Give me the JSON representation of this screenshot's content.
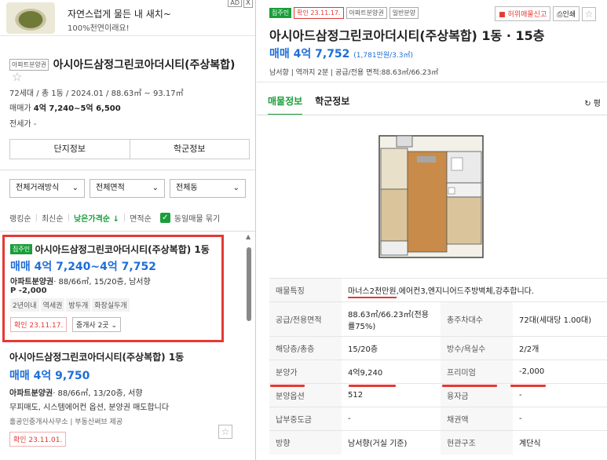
{
  "ad": {
    "title": "자연스럽게 물든 내 새치~",
    "subtitle": "100%천연이래요!",
    "tag": "AD",
    "close": "X"
  },
  "complex": {
    "badge": "아파트분양권",
    "name": "아시아드삼정그린코아더시티(주상복합)",
    "info": "72세대 / 총 1동 / 2024.01 / 88.63㎡ ~ 93.17㎡",
    "price_label": "매매가",
    "price_value": "4억 7,240~5억 6,500",
    "jeonse_label": "전세가",
    "jeonse_value": "-",
    "btn_info": "단지정보",
    "btn_school": "학군정보"
  },
  "filters": {
    "deal": "전체거래방식",
    "area": "전체면적",
    "dong": "전체동"
  },
  "sort": {
    "items": [
      "랭킹순",
      "최신순",
      "낮은가격순 ↓",
      "면적순"
    ],
    "same": "동일매물 묶기"
  },
  "listing1": {
    "tag": "집주인",
    "name": "아시아드삼정그린코아더시티(주상복합) 1동",
    "price": "매매 4억 7,240~4억 7,752",
    "type": "아파트분양권",
    "detail": "· 88/66㎡, 15/20층, 남서향",
    "premium": "P -2,000",
    "chips": [
      "2년이내",
      "역세권",
      "방두개",
      "화장실두개"
    ],
    "confirm": "확인 23.11.17.",
    "broker": "중개사 2곳"
  },
  "listing2": {
    "name": "아시아드삼정그린코아더시티(주상복합) 1동",
    "price": "매매 4억 9,750",
    "type": "아파트분양권",
    "detail": "· 88/66㎡, 13/20층, 서향",
    "desc": "무피매도, 시스템에어컨 옵션, 분양권 매도합니다",
    "source": "홀공인중개사사무소 | 부동산써브 제공",
    "confirm": "확인 23.11.01."
  },
  "detail": {
    "tags": [
      "집주인",
      "확인 23.11.17.",
      "아파트분양권",
      "일반분양"
    ],
    "report": "허위매물신고",
    "print": "인쇄",
    "title": "아시아드삼정그린코아더시티(주상복합) 1동 · 15층",
    "price": "매매 4억 7,752",
    "price_unit": "(1,781만원/3.3㎡)",
    "sub": "남서향 | 역까지 2분 | 공급/전용 면적:88.63㎡/66.23㎡",
    "tab_info": "매물정보",
    "tab_school": "학군정보",
    "refresh": "평",
    "rows": {
      "feature_k": "매물특징",
      "feature_v1": "마너스2천만원",
      "feature_v2": ",에어컨3,엔지니어드주방벽체,강추합니다.",
      "area_k": "공급/전용면적",
      "area_v": "88.63㎡/66.23㎡(전용률75%)",
      "households_k": "총주차대수",
      "households_v": "72대(세대당 1.00대)",
      "floor_k": "해당층/총층",
      "floor_v": "15/20층",
      "rooms_k": "방수/욕실수",
      "rooms_v": "2/2개",
      "sale_k": "분양가",
      "sale_v": "4억9,240",
      "premium_k": "프리미엄",
      "premium_v": "-2,000",
      "option_k": "분양옵션",
      "option_v": "512",
      "loan_k": "융자금",
      "loan_v": "-",
      "mid_k": "납부중도금",
      "mid_v": "-",
      "bond_k": "채권액",
      "bond_v": "-",
      "dir_k": "방향",
      "dir_v": "남서향(거실 기준)",
      "struct_k": "현관구조",
      "struct_v": "계단식"
    }
  }
}
